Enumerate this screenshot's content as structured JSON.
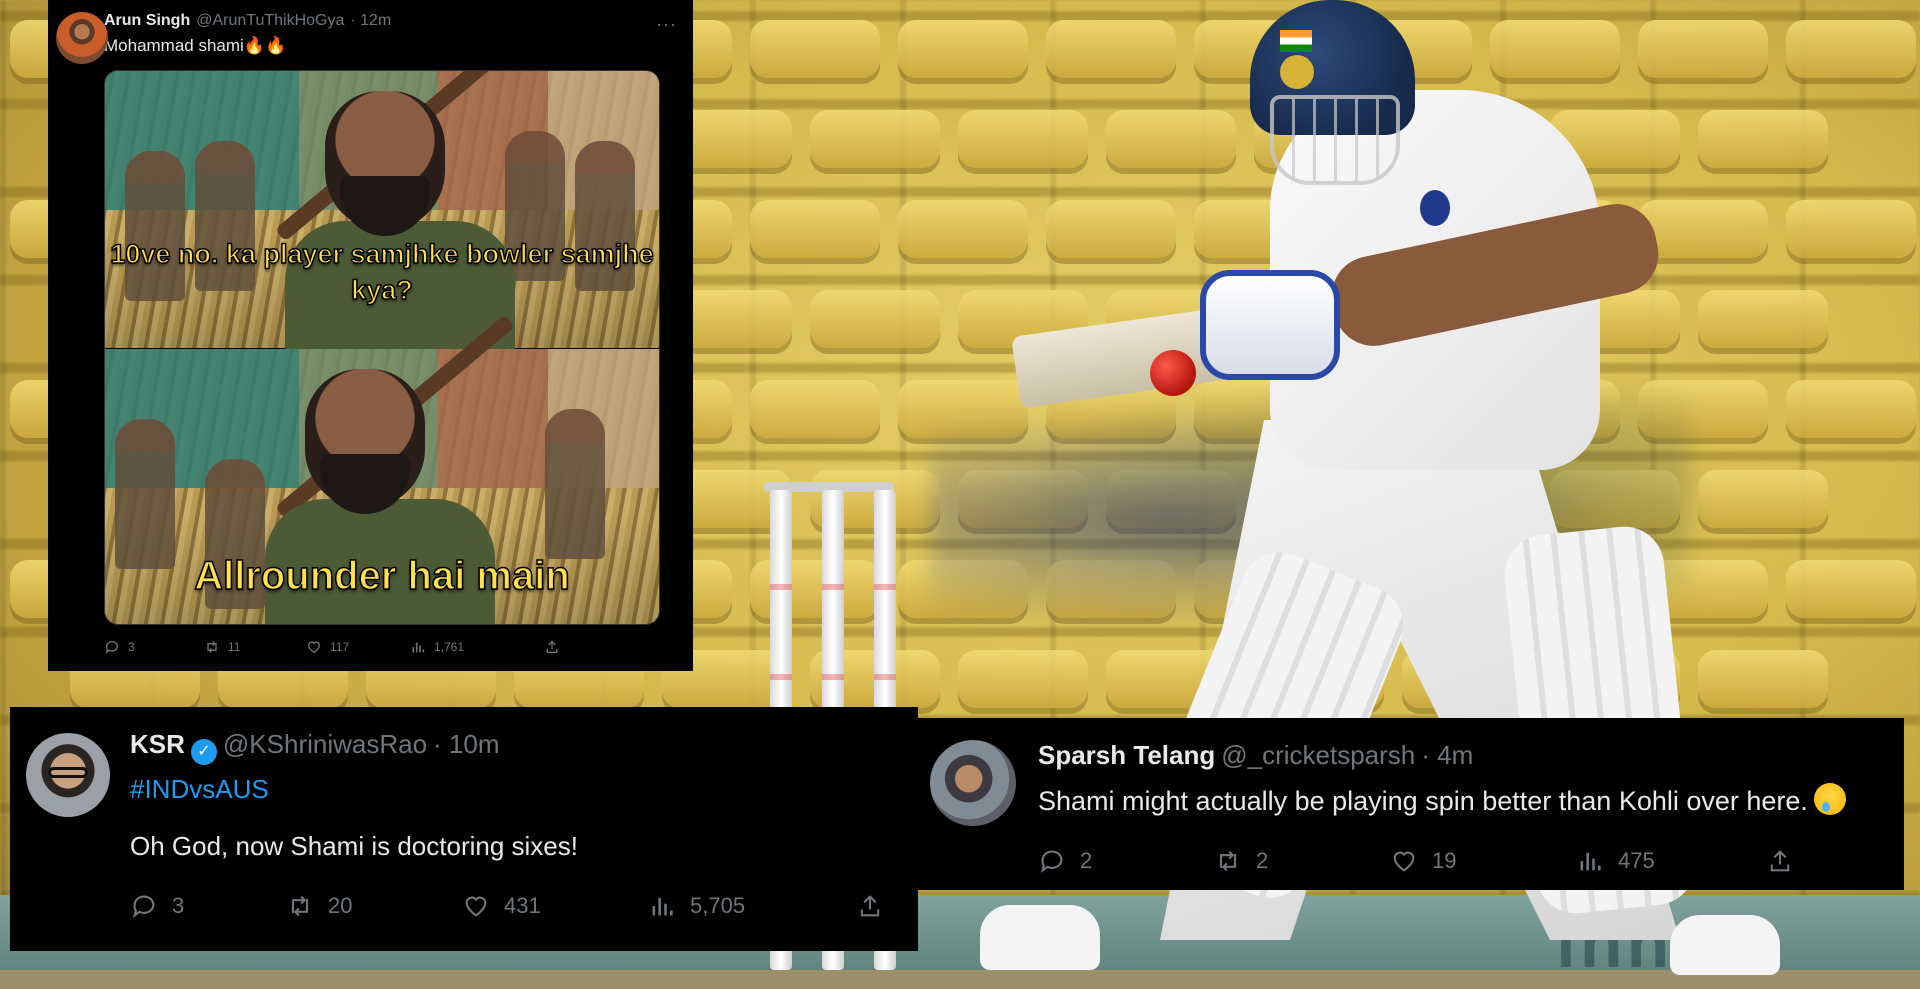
{
  "tweets": [
    {
      "author": "Arun Singh",
      "handle": "@ArunTuThikHoGya",
      "time": "· 12m",
      "text": "Mohammad shami🔥🔥",
      "media": {
        "caption_top": "10ve no. ka player samjhke bowler samjhe kya?",
        "caption_bottom": "Allrounder hai main"
      },
      "replies": "3",
      "retweets": "11",
      "likes": "117",
      "views": "1,761"
    },
    {
      "author": "KSR",
      "verified": true,
      "handle": "@KShriniwasRao",
      "time": "· 10m",
      "hashtag": "#INDvsAUS",
      "text": "Oh God, now Shami is doctoring sixes!",
      "replies": "3",
      "retweets": "20",
      "likes": "431",
      "views": "5,705"
    },
    {
      "author": "Sparsh Telang",
      "handle": "@_cricketsparsh",
      "time": "· 4m",
      "text": "Shami might actually be playing spin better than Kohli over here.",
      "replies": "2",
      "retweets": "2",
      "likes": "19",
      "views": "475"
    }
  ],
  "icons": {
    "reply": "reply-icon",
    "retweet": "retweet-icon",
    "like": "heart-icon",
    "views": "views-icon",
    "share": "share-icon",
    "more": "more-icon",
    "verified": "verified-badge-icon"
  },
  "colors": {
    "card_bg": "#000000",
    "text": "#e7e9ea",
    "muted": "#71767b",
    "link": "#1d9bf0",
    "caption": "#ffe14b"
  }
}
